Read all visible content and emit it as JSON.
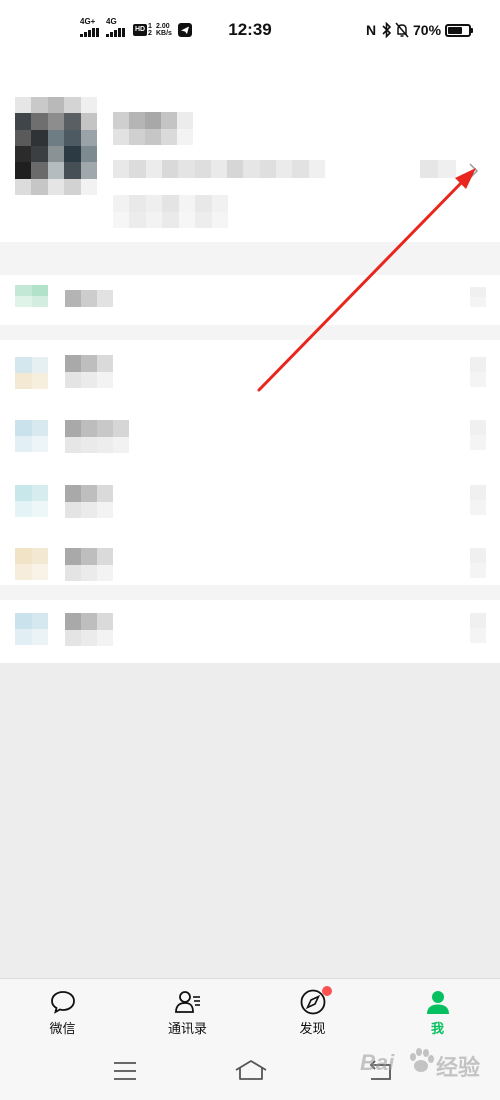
{
  "status_bar": {
    "network_1": "4G+",
    "network_2": "4G",
    "hd_label": "HD",
    "hd_sim_1": "1",
    "hd_sim_2": "2",
    "speed_value": "2.00",
    "speed_unit": "KB/s",
    "time": "12:39",
    "nfc_label": "N",
    "battery_percent": "70%",
    "battery_level": 0.7,
    "icons": [
      "signal-icon",
      "app-notification-icon",
      "nfc-icon",
      "bluetooth-icon",
      "mute-icon",
      "battery-icon"
    ]
  },
  "profile": {
    "avatar": "pixelated",
    "chevron_icon": "chevron-right-icon"
  },
  "menu_rows": [
    {
      "icon": "pixelated-icon",
      "label": "pixelated"
    },
    {
      "icon": "pixelated-icon",
      "label": "pixelated"
    },
    {
      "icon": "pixelated-icon",
      "label": "pixelated"
    },
    {
      "icon": "pixelated-icon",
      "label": "pixelated"
    },
    {
      "icon": "pixelated-icon",
      "label": "pixelated"
    },
    {
      "icon": "pixelated-icon",
      "label": "pixelated"
    }
  ],
  "tabs": [
    {
      "label": "微信",
      "icon": "chat-bubble-icon",
      "active": false
    },
    {
      "label": "通讯录",
      "icon": "contacts-icon",
      "active": false
    },
    {
      "label": "发现",
      "icon": "compass-icon",
      "active": false,
      "badge": true
    },
    {
      "label": "我",
      "icon": "person-icon",
      "active": true
    }
  ],
  "nav_bar": {
    "icons": [
      "menu-icon",
      "home-icon",
      "back-icon"
    ]
  },
  "watermark": {
    "left": "Bai",
    "right": "经验"
  },
  "colors": {
    "accent": "#07c160",
    "badge": "#fa5151",
    "annotation_arrow": "#e8261d"
  }
}
